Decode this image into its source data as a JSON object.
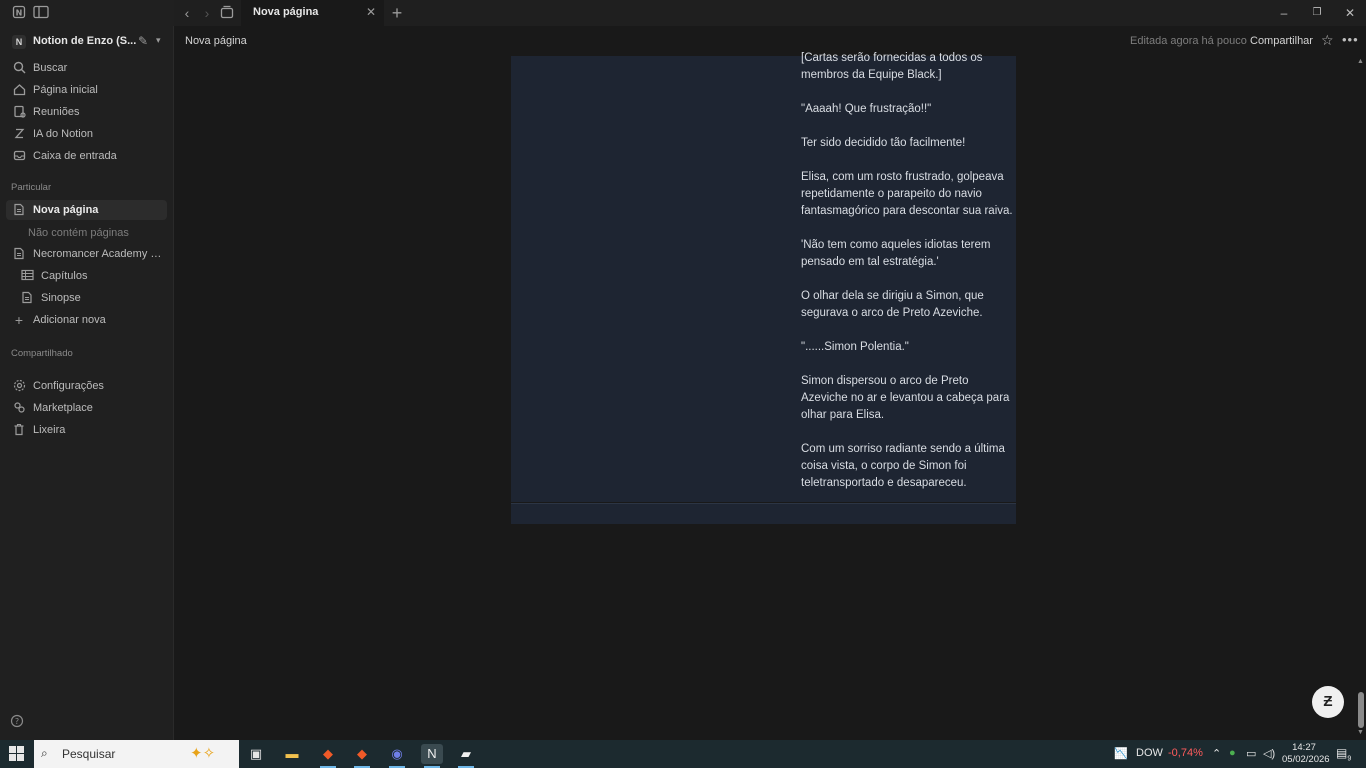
{
  "window": {
    "tab_title": "Nova página",
    "controls": {
      "minimize": "–",
      "restore": "❐",
      "close": "✕"
    }
  },
  "sidebar": {
    "workspace": {
      "badge": "N",
      "name": "Notion de Enzo (S..."
    },
    "top_items": [
      {
        "label": "Buscar",
        "icon": "search-icon"
      },
      {
        "label": "Página inicial",
        "icon": "home-icon"
      },
      {
        "label": "Reuniões",
        "icon": "meetings-icon"
      },
      {
        "label": "IA do Notion",
        "icon": "ai-icon"
      },
      {
        "label": "Caixa de entrada",
        "icon": "inbox-icon"
      }
    ],
    "section_private": "Particular",
    "private_items": [
      {
        "label": "Nova página",
        "icon": "page-icon",
        "active": true
      },
      {
        "label": "Não contém páginas",
        "icon": "",
        "sub": true
      },
      {
        "label": "Necromancer Academy Ge...",
        "icon": "page-icon"
      },
      {
        "label": "Capítulos",
        "icon": "table-icon"
      },
      {
        "label": "Sinopse",
        "icon": "page-icon"
      },
      {
        "label": "Adicionar nova",
        "icon": "plus-icon"
      }
    ],
    "section_shared": "Compartilhado",
    "bottom_items": [
      {
        "label": "Configurações",
        "icon": "settings-icon"
      },
      {
        "label": "Marketplace",
        "icon": "marketplace-icon"
      },
      {
        "label": "Lixeira",
        "icon": "trash-icon"
      }
    ]
  },
  "pagebar": {
    "title": "Nova página",
    "edited": "Editada agora há pouco",
    "share": "Compartilhar"
  },
  "document": {
    "paragraphs": [
      "[Cartas serão fornecidas a todos os membros da Equipe Black.]",
      "\"Aaaah! Que frustração!!\"",
      "Ter sido decidido tão facilmente!",
      "Elisa, com um rosto frustrado, golpeava repetidamente o parapeito do navio fantasmagórico para descontar sua raiva.",
      "'Não tem como aqueles idiotas terem pensado em tal estratégia.'",
      "O olhar dela se dirigiu a Simon, que segurava o arco de Preto Azeviche.",
      "\"......Simon Polentia.\"",
      "Simon dispersou o arco de Preto Azeviche no ar e levantou a cabeça para olhar para Elisa.",
      "Com um sorriso radiante sendo a última coisa vista, o corpo de Simon foi teletransportado e desapareceu."
    ]
  },
  "taskbar": {
    "search_placeholder": "Pesquisar",
    "ticker": {
      "name": "DOW",
      "change": "-0,74%",
      "color": "#ff5c5c"
    },
    "time": "14:27",
    "date": "05/02/2026",
    "notification_count": "9"
  }
}
